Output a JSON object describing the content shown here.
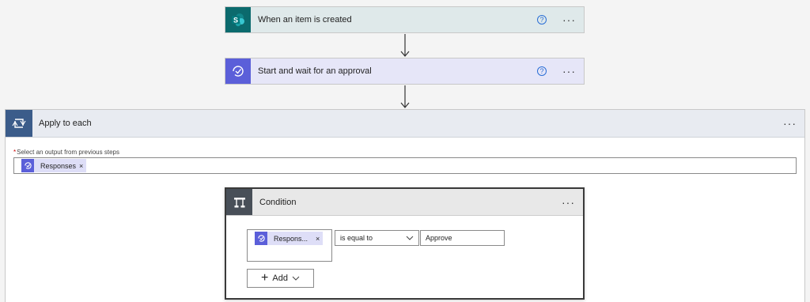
{
  "trigger": {
    "title": "When an item is created",
    "help": "?",
    "more": "···",
    "icon": "sharepoint-icon"
  },
  "approval": {
    "title": "Start and wait for an approval",
    "help": "?",
    "more": "···",
    "icon": "approvals-icon"
  },
  "apply_to_each": {
    "title": "Apply to each",
    "more": "···",
    "icon": "loop-icon",
    "field_required_mark": "*",
    "field_label": "Select an output from previous steps",
    "token": {
      "text": "Responses",
      "remove": "×"
    }
  },
  "condition": {
    "title": "Condition",
    "more": "···",
    "icon": "condition-icon",
    "left_token": {
      "text": "Respons...",
      "remove": "×"
    },
    "operator": "is equal to",
    "value": "Approve",
    "add_label": "Add"
  },
  "colors": {
    "sharepoint": "#0b6a6d",
    "approvals": "#5b5fd9",
    "apply_to_each": "#3b5c8a",
    "condition": "#484f58"
  }
}
